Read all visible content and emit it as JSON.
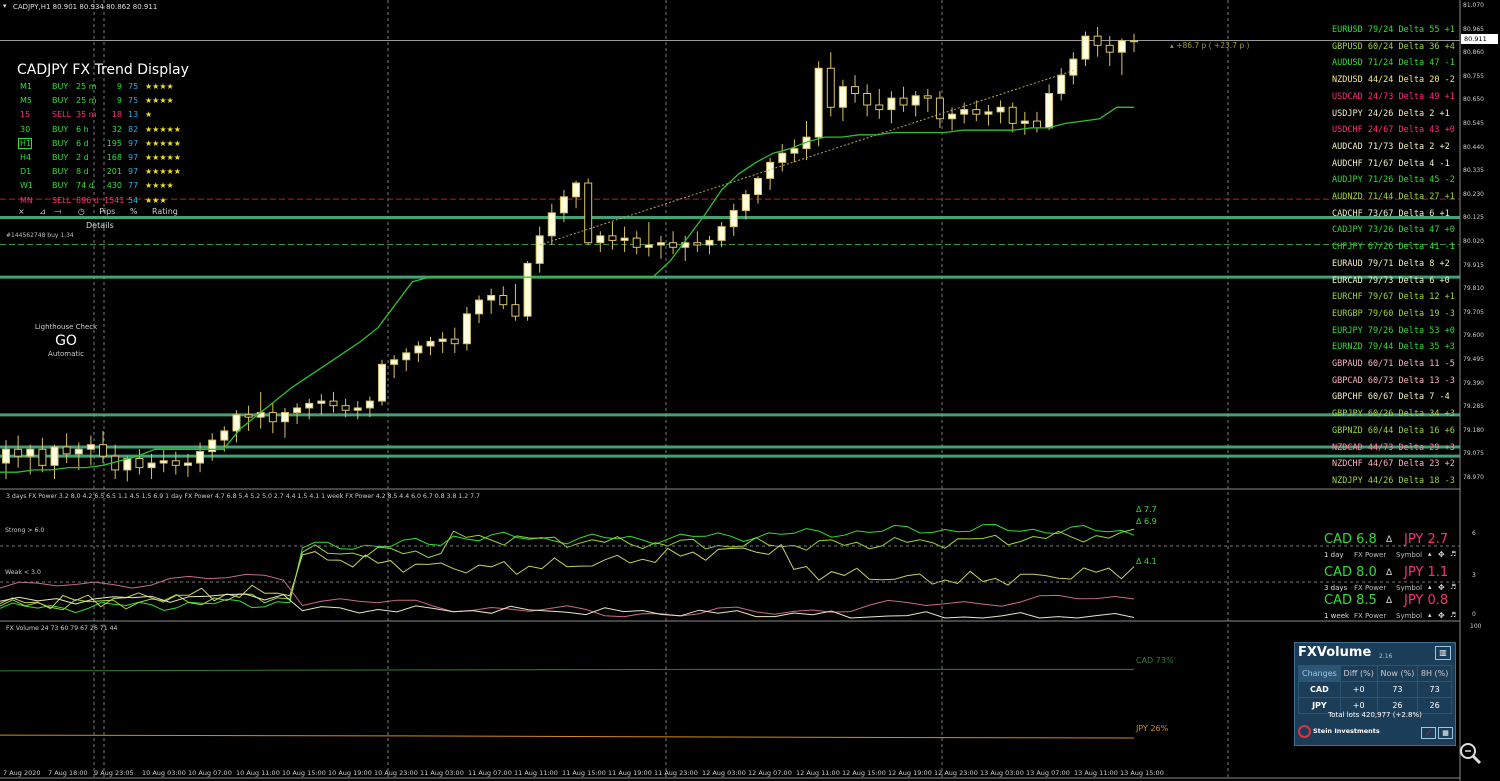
{
  "window": {
    "title": "CADJPY,H1  80.901 80.934 80.862 80.911"
  },
  "current_price": "80.911",
  "trend_display": {
    "title": "CADJPY FX Trend Display",
    "rows": [
      {
        "tf": "M1",
        "dir": "BUY",
        "dur": "25 m",
        "pips": "9",
        "pct": "75",
        "stars": "★★★★",
        "color": "#33dd33"
      },
      {
        "tf": "M5",
        "dir": "BUY",
        "dur": "25 m",
        "pips": "9",
        "pct": "75",
        "stars": "★★★★",
        "color": "#33dd33"
      },
      {
        "tf": "15",
        "dir": "SELL",
        "dur": "35 m",
        "pips": "18",
        "pct": "13",
        "stars": "★",
        "color": "#ff2d7a"
      },
      {
        "tf": "30",
        "dir": "BUY",
        "dur": "6 h",
        "pips": "32",
        "pct": "82",
        "stars": "★★★★★",
        "color": "#33dd33"
      },
      {
        "tf": "H1",
        "dir": "BUY",
        "dur": "6 d",
        "pips": "195",
        "pct": "97",
        "stars": "★★★★★",
        "color": "#33dd33"
      },
      {
        "tf": "H4",
        "dir": "BUY",
        "dur": "2 d",
        "pips": "168",
        "pct": "97",
        "stars": "★★★★★",
        "color": "#33dd33"
      },
      {
        "tf": "D1",
        "dir": "BUY",
        "dur": "8 d",
        "pips": "201",
        "pct": "97",
        "stars": "★★★★★",
        "color": "#33dd33"
      },
      {
        "tf": "W1",
        "dir": "BUY",
        "dur": "74 d",
        "pips": "430",
        "pct": "77",
        "stars": "★★★★",
        "color": "#33dd33"
      },
      {
        "tf": "MN",
        "dir": "SELL",
        "dur": "896 d",
        "pips": "1541",
        "pct": "54",
        "stars": "★★★",
        "color": "#ff2d7a"
      }
    ],
    "tools": {
      "close": "×",
      "pips": "Pips",
      "percent": "%",
      "rating": "Rating"
    },
    "details": "Details"
  },
  "order_label": "#144562748 buy 1.34",
  "lighthouse": {
    "title": "Lighthouse Check",
    "status": "GO",
    "mode": "Automatic"
  },
  "target_label": "+86.7 p ( +23.7 p )",
  "pairs": [
    {
      "text": "EURUSD 79/24 Delta 55  +1",
      "color": "#33dd33"
    },
    {
      "text": "GBPUSD 60/24 Delta 36  +4",
      "color": "#9cd63a"
    },
    {
      "text": "AUDUSD 71/24 Delta 47  -1",
      "color": "#33dd33"
    },
    {
      "text": "NZDUSD 44/24 Delta 20  -2",
      "color": "#f0f07a"
    },
    {
      "text": "USDCAD 24/73 Delta 49  +1",
      "color": "#ff2d7a"
    },
    {
      "text": "USDJPY 24/26 Delta  2  +1",
      "color": "#f0f0c0"
    },
    {
      "text": "USDCHF 24/67 Delta 43  +0",
      "color": "#ff2d7a"
    },
    {
      "text": "AUDCAD 71/73 Delta  2  +2",
      "color": "#f0f0c0"
    },
    {
      "text": "AUDCHF 71/67 Delta  4  -1",
      "color": "#f0f0c0"
    },
    {
      "text": "AUDJPY 71/26 Delta 45  -2",
      "color": "#33dd33"
    },
    {
      "text": "AUDNZD 71/44 Delta 27  +1",
      "color": "#9cd63a"
    },
    {
      "text": "CADCHF 73/67 Delta  6  +1",
      "color": "#f0f0c0"
    },
    {
      "text": "CADJPY 73/26 Delta 47  +0",
      "color": "#33dd33"
    },
    {
      "text": "CHFJPY 67/26 Delta 41  -1",
      "color": "#33dd33"
    },
    {
      "text": "EURAUD 79/71 Delta  8  +2",
      "color": "#f0f0c0"
    },
    {
      "text": "EURCAD 79/73 Delta  6  +0",
      "color": "#f0f0c0"
    },
    {
      "text": "EURCHF 79/67 Delta 12  +1",
      "color": "#9cd63a"
    },
    {
      "text": "EURGBP 79/60 Delta 19  -3",
      "color": "#9cd63a"
    },
    {
      "text": "EURJPY 79/26 Delta 53  +0",
      "color": "#33dd33"
    },
    {
      "text": "EURNZD 79/44 Delta 35  +3",
      "color": "#33dd33"
    },
    {
      "text": "GBPAUD 60/71 Delta 11  -5",
      "color": "#ffb0c0"
    },
    {
      "text": "GBPCAD 60/73 Delta 13  -3",
      "color": "#ffb0c0"
    },
    {
      "text": "GBPCHF 60/67 Delta  7  -4",
      "color": "#f0f0c0"
    },
    {
      "text": "GBPJPY 60/26 Delta 34  +3",
      "color": "#9cd63a"
    },
    {
      "text": "GBPNZD 60/44 Delta 16  +6",
      "color": "#9cd63a"
    },
    {
      "text": "NZDCAD 44/73 Delta 29  +3",
      "color": "#ff80a0"
    },
    {
      "text": "NZDCHF 44/67 Delta 23  +2",
      "color": "#ffb0c0"
    },
    {
      "text": "NZDJPY 44/26 Delta 18  -3",
      "color": "#9cd63a"
    }
  ],
  "price_ticks": [
    "81.070",
    "80.965",
    "80.860",
    "80.755",
    "80.650",
    "80.545",
    "80.440",
    "80.335",
    "80.230",
    "80.125",
    "80.020",
    "79.915",
    "79.810",
    "79.705",
    "79.600",
    "79.495",
    "79.390",
    "79.285",
    "79.180",
    "79.075",
    "78.970"
  ],
  "time_labels": [
    "7 Aug 2020",
    "7 Aug 18:00",
    "9 Aug 23:05",
    "10 Aug 03:00",
    "10 Aug 07:00",
    "10 Aug 11:00",
    "10 Aug 15:00",
    "10 Aug 19:00",
    "10 Aug 23:00",
    "11 Aug 03:00",
    "11 Aug 07:00",
    "11 Aug 11:00",
    "11 Aug 15:00",
    "11 Aug 19:00",
    "11 Aug 23:00",
    "12 Aug 03:00",
    "12 Aug 07:00",
    "12 Aug 11:00",
    "12 Aug 15:00",
    "12 Aug 19:00",
    "12 Aug 23:00",
    "13 Aug 03:00",
    "13 Aug 07:00",
    "13 Aug 11:00",
    "13 Aug 15:00"
  ],
  "fx_power": {
    "header": "3 days FX Power 3.2 8.0 4.2 6.5 6.5 1.1 4.5 1.5 6.9   1 day FX Power 4.7 6.8 5.4 5.2 5.0 2.7 4.4 1.5 4.1   1 week FX Power 4.2 8.5 4.4 6.0 6.7 0.8 3.8 1.2 7.7",
    "strong_label": "Strong > 6.0",
    "weak_label": "Weak < 3.0",
    "delta_labels": [
      "Δ 7.7",
      "Δ 6.9",
      "Δ 4.1"
    ],
    "ticks": [
      "6",
      "3",
      "0"
    ],
    "blocks": [
      {
        "base": "CAD 6.8",
        "delta": "Δ",
        "quote": "JPY 2.7",
        "period": "1 day",
        "fxp": "FX Power",
        "sym": "Symbol"
      },
      {
        "base": "CAD 8.0",
        "delta": "Δ",
        "quote": "JPY 1.1",
        "period": "3 days",
        "fxp": "FX Power",
        "sym": "Symbol"
      },
      {
        "base": "CAD 8.5",
        "delta": "Δ",
        "quote": "JPY 0.8",
        "period": "1 week",
        "fxp": "FX Power",
        "sym": "Symbol"
      }
    ]
  },
  "fx_volume": {
    "header": "FX Volume 24 73 60 79 67 26 71 44",
    "tick_top": "100",
    "cad_label": "CAD 73%",
    "jpy_label": "JPY 26%",
    "panel": {
      "title": "FXVolume",
      "version": "2.16",
      "headers": [
        "Changes",
        "Diff (%)",
        "Now (%)",
        "8H (%)"
      ],
      "rows": [
        [
          "CAD",
          "+0",
          "73",
          "73"
        ],
        [
          "JPY",
          "+0",
          "26",
          "26"
        ]
      ],
      "total": "Total lots 420,977 (+2.8%)",
      "brand": "Stein Investments"
    }
  },
  "colors": {
    "bull": "#ffffe0",
    "bear": "#000000",
    "candle_outline": "#d9c36a",
    "stop_line": "#2ebf2e",
    "hline": "#4fbf8a",
    "red_line": "#b81f1f",
    "dash_green": "#3a8f3a",
    "accent_green": "#33dd33",
    "accent_pink": "#ff2d7a"
  },
  "chart_data": {
    "type": "candlestick",
    "symbol": "CADJPY",
    "timeframe": "H1",
    "ylim": [
      78.97,
      81.07
    ],
    "candles": [
      [
        79.07,
        79.17,
        79.0,
        79.13
      ],
      [
        79.13,
        79.19,
        79.05,
        79.1
      ],
      [
        79.1,
        79.15,
        79.02,
        79.13
      ],
      [
        79.13,
        79.18,
        79.03,
        79.06
      ],
      [
        79.06,
        79.15,
        79.0,
        79.14
      ],
      [
        79.14,
        79.2,
        79.07,
        79.11
      ],
      [
        79.11,
        79.16,
        79.04,
        79.13
      ],
      [
        79.13,
        79.19,
        79.06,
        79.15
      ],
      [
        79.15,
        79.21,
        79.07,
        79.1
      ],
      [
        79.1,
        79.15,
        79.0,
        79.04
      ],
      [
        79.04,
        79.1,
        78.99,
        79.09
      ],
      [
        79.09,
        79.13,
        79.02,
        79.05
      ],
      [
        79.05,
        79.11,
        79.0,
        79.07
      ],
      [
        79.07,
        79.13,
        79.03,
        79.08
      ],
      [
        79.08,
        79.12,
        79.02,
        79.06
      ],
      [
        79.06,
        79.11,
        79.01,
        79.07
      ],
      [
        79.07,
        79.16,
        79.03,
        79.12
      ],
      [
        79.12,
        79.2,
        79.08,
        79.17
      ],
      [
        79.17,
        79.23,
        79.12,
        79.21
      ],
      [
        79.21,
        79.3,
        79.16,
        79.28
      ],
      [
        79.28,
        79.32,
        79.21,
        79.27
      ],
      [
        79.27,
        79.38,
        79.22,
        79.29
      ],
      [
        79.29,
        79.33,
        79.2,
        79.25
      ],
      [
        79.25,
        79.31,
        79.18,
        79.29
      ],
      [
        79.29,
        79.33,
        79.24,
        79.31
      ],
      [
        79.31,
        79.35,
        79.26,
        79.33
      ],
      [
        79.33,
        79.37,
        79.28,
        79.34
      ],
      [
        79.34,
        79.38,
        79.29,
        79.32
      ],
      [
        79.32,
        79.35,
        79.27,
        79.3
      ],
      [
        79.3,
        79.34,
        79.26,
        79.31
      ],
      [
        79.31,
        79.36,
        79.27,
        79.34
      ],
      [
        79.34,
        79.52,
        79.32,
        79.5
      ],
      [
        79.5,
        79.54,
        79.44,
        79.52
      ],
      [
        79.52,
        79.57,
        79.47,
        79.55
      ],
      [
        79.55,
        79.6,
        79.51,
        79.58
      ],
      [
        79.58,
        79.62,
        79.54,
        79.6
      ],
      [
        79.6,
        79.64,
        79.55,
        79.61
      ],
      [
        79.61,
        79.66,
        79.55,
        79.59
      ],
      [
        79.59,
        79.75,
        79.56,
        79.72
      ],
      [
        79.72,
        79.8,
        79.68,
        79.78
      ],
      [
        79.78,
        79.83,
        79.72,
        79.8
      ],
      [
        79.8,
        79.84,
        79.74,
        79.76
      ],
      [
        79.76,
        79.85,
        79.69,
        79.71
      ],
      [
        79.71,
        79.95,
        79.69,
        79.94
      ],
      [
        79.94,
        80.1,
        79.9,
        80.06
      ],
      [
        80.06,
        80.2,
        80.02,
        80.16
      ],
      [
        80.16,
        80.26,
        80.12,
        80.23
      ],
      [
        80.23,
        80.3,
        80.18,
        80.29
      ],
      [
        80.29,
        80.31,
        80.02,
        80.03
      ],
      [
        80.03,
        80.08,
        79.99,
        80.06
      ],
      [
        80.06,
        80.12,
        80.0,
        80.04
      ],
      [
        80.04,
        80.1,
        79.99,
        80.05
      ],
      [
        80.05,
        80.08,
        79.98,
        80.01
      ],
      [
        80.01,
        80.12,
        79.97,
        80.02
      ],
      [
        80.02,
        80.06,
        79.96,
        80.03
      ],
      [
        80.03,
        80.08,
        79.98,
        80.01
      ],
      [
        80.01,
        80.06,
        79.95,
        80.03
      ],
      [
        80.03,
        80.08,
        79.99,
        80.02
      ],
      [
        80.02,
        80.06,
        79.98,
        80.04
      ],
      [
        80.04,
        80.12,
        80.01,
        80.1
      ],
      [
        80.1,
        80.2,
        80.06,
        80.17
      ],
      [
        80.17,
        80.26,
        80.13,
        80.24
      ],
      [
        80.24,
        80.32,
        80.2,
        80.31
      ],
      [
        80.31,
        80.4,
        80.26,
        80.38
      ],
      [
        80.38,
        80.46,
        80.34,
        80.42
      ],
      [
        80.42,
        80.48,
        80.38,
        80.44
      ],
      [
        80.44,
        80.56,
        80.39,
        80.49
      ],
      [
        80.49,
        80.82,
        80.45,
        80.79
      ],
      [
        80.79,
        80.86,
        80.58,
        80.62
      ],
      [
        80.62,
        80.74,
        80.56,
        80.71
      ],
      [
        80.71,
        80.76,
        80.64,
        80.68
      ],
      [
        80.68,
        80.72,
        80.58,
        80.63
      ],
      [
        80.63,
        80.7,
        80.57,
        80.61
      ],
      [
        80.61,
        80.69,
        80.55,
        80.66
      ],
      [
        80.66,
        80.71,
        80.6,
        80.63
      ],
      [
        80.63,
        80.69,
        80.58,
        80.67
      ],
      [
        80.67,
        80.7,
        80.6,
        80.66
      ],
      [
        80.66,
        80.69,
        80.53,
        80.57
      ],
      [
        80.57,
        80.62,
        80.52,
        80.59
      ],
      [
        80.59,
        80.64,
        80.55,
        80.61
      ],
      [
        80.61,
        80.65,
        80.56,
        80.59
      ],
      [
        80.59,
        80.63,
        80.54,
        80.6
      ],
      [
        80.6,
        80.65,
        80.55,
        80.62
      ],
      [
        80.62,
        80.64,
        80.51,
        80.55
      ],
      [
        80.55,
        80.6,
        80.5,
        80.56
      ],
      [
        80.56,
        80.6,
        80.51,
        80.53
      ],
      [
        80.53,
        80.72,
        80.52,
        80.68
      ],
      [
        80.68,
        80.79,
        80.65,
        80.76
      ],
      [
        80.76,
        80.86,
        80.72,
        80.83
      ],
      [
        80.83,
        80.95,
        80.8,
        80.93
      ],
      [
        80.93,
        80.97,
        80.84,
        80.89
      ],
      [
        80.89,
        80.93,
        80.8,
        80.86
      ],
      [
        80.86,
        80.92,
        80.76,
        80.91
      ],
      [
        80.91,
        80.94,
        80.86,
        80.91
      ]
    ],
    "stop_line": [
      79.03,
      79.03,
      79.04,
      79.04,
      79.05,
      79.05,
      79.06,
      79.08,
      79.1,
      79.13,
      79.13,
      79.13,
      79.13,
      79.13,
      79.22,
      79.28,
      79.34,
      79.4,
      79.45,
      79.5,
      79.55,
      79.6,
      79.66,
      79.76,
      79.86,
      79.88,
      79.88,
      79.88,
      79.88,
      79.88,
      79.88,
      79.88,
      79.88,
      79.88,
      79.88,
      79.88,
      79.88,
      79.88,
      79.88,
      79.95,
      80.05,
      80.15,
      80.26,
      80.33,
      80.38,
      80.42,
      80.44,
      80.47,
      80.49,
      80.49,
      80.5,
      80.5,
      80.51,
      80.51,
      80.51,
      80.51,
      80.52,
      80.52,
      80.52,
      80.52,
      80.53,
      80.53,
      80.55,
      80.56,
      80.57,
      80.62,
      80.62
    ],
    "horizontal_levels": [
      80.14,
      79.88,
      79.28,
      79.14,
      79.1
    ],
    "red_level": 80.22
  }
}
